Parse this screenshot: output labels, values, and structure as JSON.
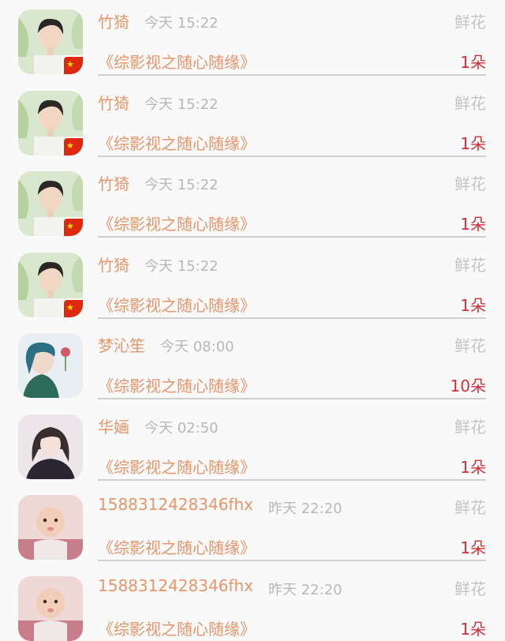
{
  "gift_records": [
    {
      "user": "竹猗",
      "time": "今天 15:22",
      "gift": "鲜花",
      "work": "《综影视之随心随缘》",
      "count": "1朵",
      "avatar": "man-portrait-icon",
      "has_flag": true
    },
    {
      "user": "竹猗",
      "time": "今天 15:22",
      "gift": "鲜花",
      "work": "《综影视之随心随缘》",
      "count": "1朵",
      "avatar": "man-portrait-icon",
      "has_flag": true
    },
    {
      "user": "竹猗",
      "time": "今天 15:22",
      "gift": "鲜花",
      "work": "《综影视之随心随缘》",
      "count": "1朵",
      "avatar": "man-portrait-icon",
      "has_flag": true
    },
    {
      "user": "竹猗",
      "time": "今天 15:22",
      "gift": "鲜花",
      "work": "《综影视之随心随缘》",
      "count": "1朵",
      "avatar": "man-portrait-icon",
      "has_flag": true
    },
    {
      "user": "梦沁笙",
      "time": "今天 08:00",
      "gift": "鲜花",
      "work": "《综影视之随心随缘》",
      "count": "10朵",
      "avatar": "girl-with-flower-icon",
      "has_flag": false
    },
    {
      "user": "华婳",
      "time": "今天 02:50",
      "gift": "鲜花",
      "work": "《综影视之随心随缘》",
      "count": "1朵",
      "avatar": "girl-portrait-icon",
      "has_flag": false
    },
    {
      "user": "1588312428346fhx",
      "time": "昨天 22:20",
      "gift": "鲜花",
      "work": "《综影视之随心随缘》",
      "count": "1朵",
      "avatar": "baby-portrait-icon",
      "has_flag": false
    },
    {
      "user": "1588312428346fhx",
      "time": "昨天 22:20",
      "gift": "鲜花",
      "work": "《综影视之随心随缘》",
      "count": "1朵",
      "avatar": "baby-portrait-icon",
      "has_flag": false
    }
  ],
  "colors": {
    "username": "#e8956a",
    "work_title": "#e8956a",
    "count": "#d32f3a",
    "meta_gray": "#b8b8b8",
    "divider": "#cfcfcf",
    "flag_red": "#de2910"
  }
}
